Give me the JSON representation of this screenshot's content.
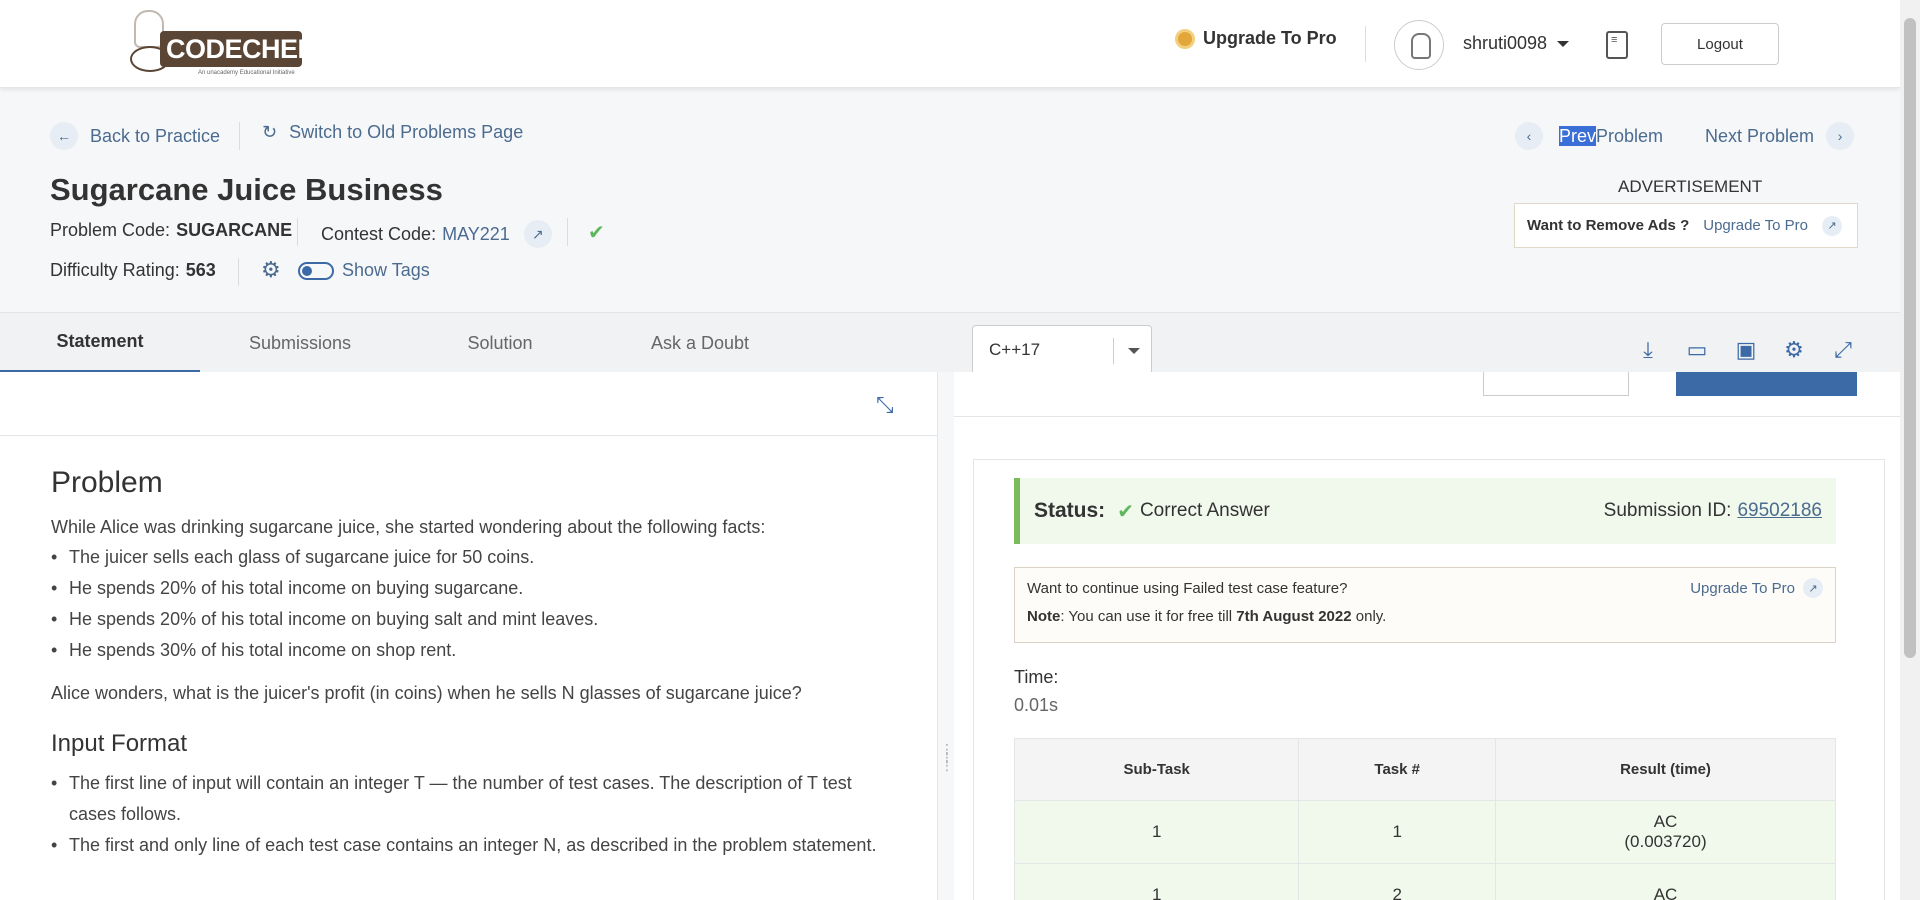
{
  "header": {
    "logo_text": "CODECHEF",
    "logo_tagline": "An unacademy Educational Initiative",
    "upgrade_label": "Upgrade To Pro",
    "username": "shruti0098",
    "logout_label": "Logout"
  },
  "nav": {
    "back_label": "Back to Practice",
    "switch_label": "Switch to Old Problems Page",
    "prev_highlight": "Prev",
    "prev_rest": "Problem",
    "next_label": "Next Problem"
  },
  "problem": {
    "title": "Sugarcane Juice Business",
    "code_label": "Problem Code:",
    "code": "SUGARCANE",
    "contest_label": "Contest Code:",
    "contest": "MAY221",
    "difficulty_label": "Difficulty Rating:",
    "difficulty": "563",
    "show_tags_label": "Show Tags"
  },
  "ad": {
    "label": "ADVERTISEMENT",
    "question": "Want to Remove Ads ?",
    "upgrade": "Upgrade To Pro"
  },
  "tabs": [
    {
      "label": "Statement"
    },
    {
      "label": "Submissions"
    },
    {
      "label": "Solution"
    },
    {
      "label": "Ask a Doubt"
    }
  ],
  "editor": {
    "language": "C++17"
  },
  "statement": {
    "heading": "Problem",
    "intro": "While Alice was drinking sugarcane juice, she started wondering about the following facts:",
    "facts": [
      "The juicer sells each glass of sugarcane juice for 50 coins.",
      "He spends 20% of his total income on buying sugarcane.",
      "He spends 20% of his total income on buying salt and mint leaves.",
      "He spends 30% of his total income on shop rent."
    ],
    "question": "Alice wonders, what is the juicer's profit (in coins) when he sells N glasses of sugarcane juice?",
    "input_heading": "Input Format",
    "input_items": [
      "The first line of input will contain an integer T — the number of test cases. The description of T test cases follows.",
      "The first and only line of each test case contains an integer N, as described in the problem statement."
    ]
  },
  "result": {
    "status_label": "Status:",
    "status_value": "Correct Answer",
    "submission_label": "Submission ID:",
    "submission_id": "69502186",
    "feature_question": "Want to continue using Failed test case feature?",
    "feature_upgrade": "Upgrade To Pro",
    "note_label": "Note",
    "note_text_1": ": You can use it for free till ",
    "note_date": "7th August 2022",
    "note_text_2": " only.",
    "time_label": "Time:",
    "time_value": "0.01s",
    "table_headers": [
      "Sub-Task",
      "Task #",
      "Result (time)"
    ],
    "rows": [
      {
        "subtask": "1",
        "task": "1",
        "result": "AC",
        "time": "(0.003720)"
      },
      {
        "subtask": "1",
        "task": "2",
        "result": "AC",
        "time": ""
      }
    ]
  }
}
